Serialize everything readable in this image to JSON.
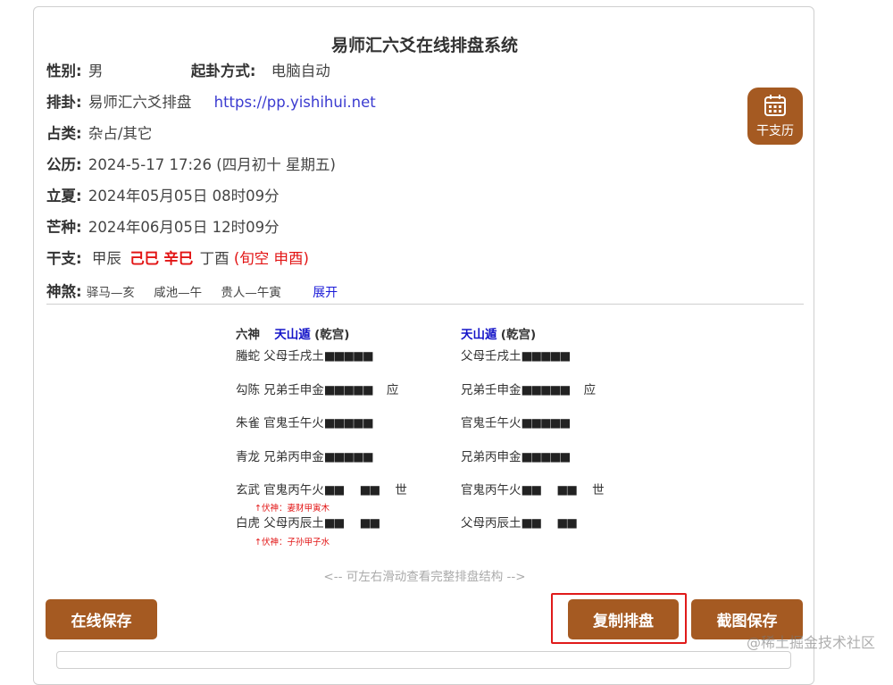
{
  "title": "易师汇六爻在线排盘系统",
  "info": {
    "gender_label": "性别:",
    "gender": "男",
    "method_label": "起卦方式:",
    "method": "电脑自动",
    "paipan_label": "排卦:",
    "paipan": "易师汇六爻排盘",
    "url": "https://pp.yishihui.net",
    "category_label": "占类:",
    "category": "杂占/其它",
    "gongli_label": "公历:",
    "gongli": "2024-5-17 17:26 (四月初十 星期五)",
    "lixia_label": "立夏:",
    "lixia": "2024年05月05日 08时09分",
    "mangzhong_label": "芒种:",
    "mangzhong": "2024年06月05日 12时09分",
    "ganzhi_label": "干支:",
    "gz1": "甲辰",
    "gz2": "己巳",
    "gz3": "辛巳",
    "gz4": "丁酉",
    "xunkong": "(旬空 申酉)",
    "shensha_label": "神煞:",
    "s1": "驿马—亥",
    "s2": "咸池—午",
    "s3": "贵人—午寅",
    "expand": "展开"
  },
  "calendar_button": {
    "label": "干支历",
    "icon": "calendar-icon"
  },
  "gua": {
    "left_header_prefix": "六神",
    "left_name": "天山遁",
    "left_palace": "(乾宫)",
    "right_name": "天山遁",
    "right_palace": "(乾宫)",
    "lines": [
      {
        "shen": "螣蛇",
        "left": "父母壬戌土",
        "right": "父母壬戌土",
        "yao": "■■■■■",
        "mark": ""
      },
      {
        "shen": "勾陈",
        "left": "兄弟壬申金",
        "right": "兄弟壬申金",
        "yao": "■■■■■",
        "mark": "应"
      },
      {
        "shen": "朱雀",
        "left": "官鬼壬午火",
        "right": "官鬼壬午火",
        "yao": "■■■■■",
        "mark": ""
      },
      {
        "shen": "青龙",
        "left": "兄弟丙申金",
        "right": "兄弟丙申金",
        "yao": "■■■■■",
        "mark": ""
      },
      {
        "shen": "玄武",
        "left": "官鬼丙午火",
        "right": "官鬼丙午火",
        "yao_a": "■■",
        "yao_b": "■■",
        "mark": "世"
      },
      {
        "shen": "白虎",
        "left": "父母丙辰土",
        "right": "父母丙辰土",
        "yao_a": "■■",
        "yao_b": "■■",
        "mark": ""
      }
    ],
    "fushen1": "↑伏神：妻财甲寅木",
    "fushen2": "↑伏神：子孙甲子水"
  },
  "hint": "<-- 可左右滑动查看完整排盘结构 -->",
  "buttons": {
    "save_online": "在线保存",
    "copy": "复制排盘",
    "screenshot": "截图保存"
  },
  "watermark": "@稀土掘金技术社区"
}
